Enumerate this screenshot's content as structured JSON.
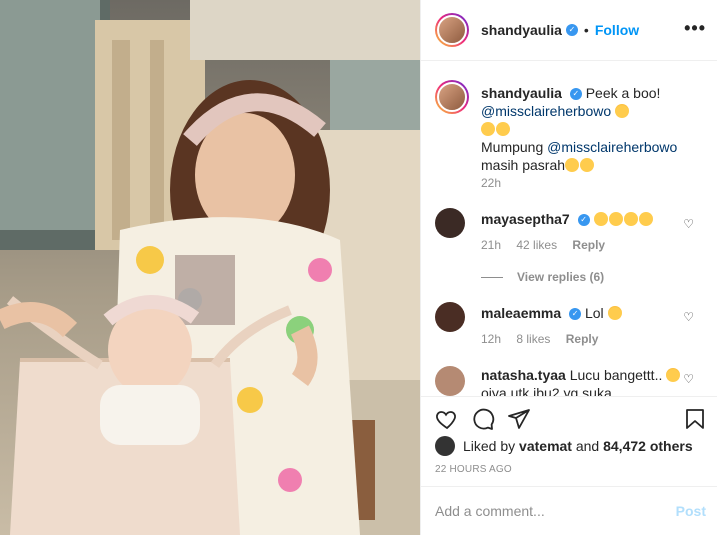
{
  "post": {
    "username": "shandyaulia",
    "follow_label": "Follow",
    "separator": "•",
    "more_label": "•••"
  },
  "caption": {
    "username": "shandyaulia",
    "line1": "Peek a boo!",
    "mention1": "@missclaireherbowo",
    "line3_prefix": "Mumpung",
    "mention2": "@missclaireherbowo",
    "line4": "masih pasrah",
    "time": "22h"
  },
  "comments": [
    {
      "username": "mayaseptha7",
      "verified": true,
      "time": "21h",
      "likes": "42 likes",
      "reply": "Reply"
    },
    {
      "username": "maleaemma",
      "verified": true,
      "text": "Lol",
      "time": "12h",
      "likes": "8 likes",
      "reply": "Reply"
    },
    {
      "username": "natasha.tyaa",
      "text": "Lucu bangettt..",
      "text2": "oiya utk ibu2 yg suka"
    }
  ],
  "view_replies": "View replies (6)",
  "likes": {
    "liked_by": "Liked by",
    "user": "vatemat",
    "and": "and",
    "count": "84,472 others"
  },
  "date": "22 HOURS AGO",
  "add_comment": {
    "placeholder": "Add a comment...",
    "post_label": "Post"
  },
  "colors": {
    "accent": "#0095f6",
    "muted": "#8e8e8e",
    "border": "#efefef"
  },
  "icons": [
    "heart-icon",
    "comment-icon",
    "share-icon",
    "bookmark-icon",
    "more-icon",
    "verified-icon"
  ]
}
